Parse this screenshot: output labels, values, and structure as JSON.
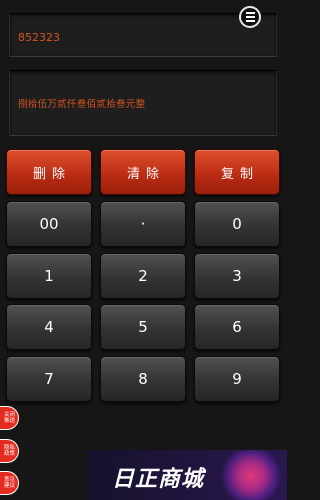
{
  "display": {
    "number": "852323",
    "chinese": "捌拾伍万贰仟叁佰贰拾叁元整"
  },
  "menu": {
    "icon": "hamburger-menu-icon"
  },
  "action_keys": [
    {
      "label": "删除"
    },
    {
      "label": "清除"
    },
    {
      "label": "复制"
    }
  ],
  "keypad": [
    [
      "00",
      "·",
      "0"
    ],
    [
      "1",
      "2",
      "3"
    ],
    [
      "4",
      "5",
      "6"
    ],
    [
      "7",
      "8",
      "9"
    ]
  ],
  "floating_buttons": [
    {
      "label": "关闭\n推送"
    },
    {
      "label": "隐私\n政策"
    },
    {
      "label": "意见\n建议"
    }
  ],
  "banner": {
    "text": "日正商城"
  },
  "colors": {
    "accent_text": "#d9531e",
    "action_key": "#c0341a",
    "floating_button": "#e42b1f"
  }
}
